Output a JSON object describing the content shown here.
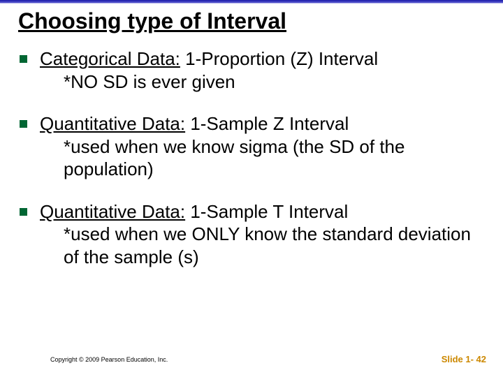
{
  "title": "Choosing type of Interval",
  "bullets": [
    {
      "lead": "Categorical Data:",
      "rest": " 1-Proportion (Z) Interval",
      "sub": "*NO SD is ever given"
    },
    {
      "lead": "Quantitative Data:",
      "rest": " 1-Sample Z Interval",
      "sub": "*used when we know sigma (the SD of the population)"
    },
    {
      "lead": "Quantitative Data:",
      "rest": " 1-Sample T Interval",
      "sub": "*used when we ONLY know the standard deviation of the sample (s)"
    }
  ],
  "copyright": "Copyright © 2009 Pearson Education, Inc.",
  "slide_number": "Slide 1- 42"
}
